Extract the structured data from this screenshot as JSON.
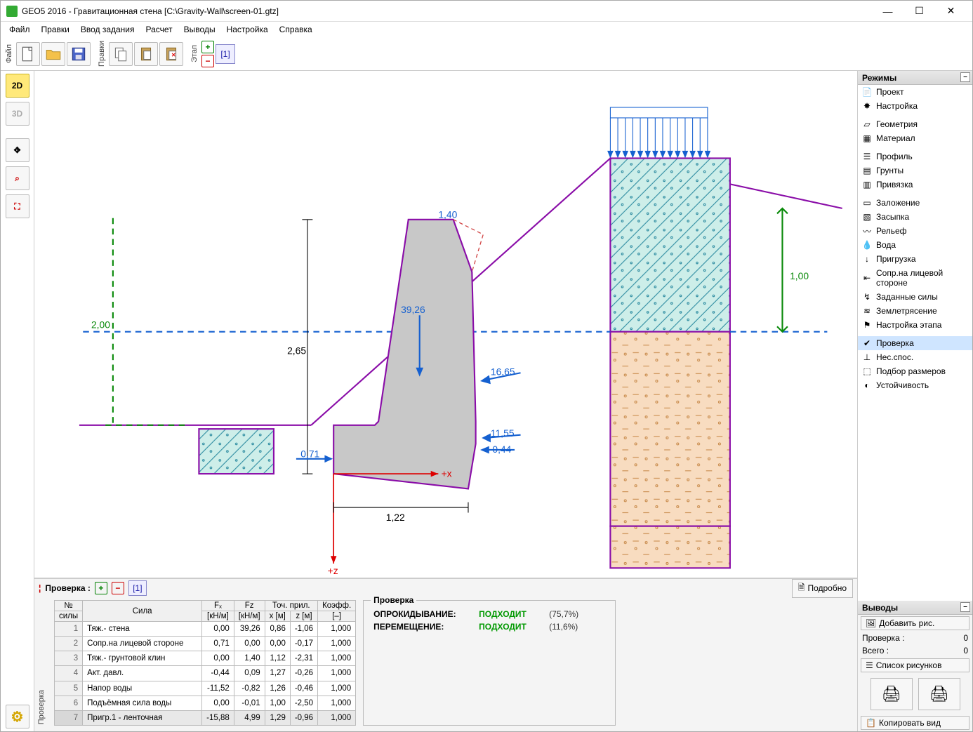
{
  "window": {
    "title": "GEO5 2016 - Гравитационная стена [C:\\Gravity-Wall\\screen-01.gtz]"
  },
  "menu": {
    "file": "Файл",
    "edit": "Правки",
    "input": "Ввод задания",
    "calc": "Расчет",
    "outputs": "Выводы",
    "settings": "Настройка",
    "help": "Справка"
  },
  "toolbar": {
    "file_label": "Файл",
    "edit_label": "Правки",
    "stage_label": "Этап",
    "stage_num": "[1]"
  },
  "left": {
    "d2": "2D",
    "d3": "3D"
  },
  "modes": {
    "header": "Режимы",
    "items": [
      "Проект",
      "Настройка",
      "Геометрия",
      "Материал",
      "Профиль",
      "Грунты",
      "Привязка",
      "Заложение",
      "Засыпка",
      "Рельеф",
      "Вода",
      "Пригрузка",
      "Сопр.на лицевой стороне",
      "Заданные силы",
      "Землетрясение",
      "Настройка этапа",
      "Проверка",
      "Нес.спос.",
      "Подбор размеров",
      "Устойчивость"
    ]
  },
  "outputs": {
    "header": "Выводы",
    "add_pic": "Добавить рис.",
    "check": "Проверка :",
    "check_n": "0",
    "total": "Всего :",
    "total_n": "0",
    "list": "Список рисунков",
    "copy": "Копировать вид"
  },
  "bottom": {
    "vlabel": "Проверка",
    "label": "Проверка :",
    "stage": "[1]",
    "detail": "Подробно"
  },
  "table": {
    "h_no": "№",
    "h_no2": "силы",
    "h_force": "Сила",
    "h_fx": "Fₓ",
    "h_fx2": "[кН/м]",
    "h_fz": "Fz",
    "h_fz2": "[кН/м]",
    "h_pt": "Точ. прил.",
    "h_x": "x [м]",
    "h_z": "z [м]",
    "h_k": "Коэфф.",
    "h_k2": "[–]",
    "rows": [
      {
        "n": "1",
        "name": "Тяж.- стена",
        "fx": "0,00",
        "fz": "39,26",
        "x": "0,86",
        "z": "-1,06",
        "k": "1,000"
      },
      {
        "n": "2",
        "name": "Сопр.на лицевой стороне",
        "fx": "0,71",
        "fz": "0,00",
        "x": "0,00",
        "z": "-0,17",
        "k": "1,000"
      },
      {
        "n": "3",
        "name": "Тяж.- грунтовой клин",
        "fx": "0,00",
        "fz": "1,40",
        "x": "1,12",
        "z": "-2,31",
        "k": "1,000"
      },
      {
        "n": "4",
        "name": "Акт. давл.",
        "fx": "-0,44",
        "fz": "0,09",
        "x": "1,27",
        "z": "-0,26",
        "k": "1,000"
      },
      {
        "n": "5",
        "name": "Напор воды",
        "fx": "-11,52",
        "fz": "-0,82",
        "x": "1,26",
        "z": "-0,46",
        "k": "1,000"
      },
      {
        "n": "6",
        "name": "Подъёмная сила воды",
        "fx": "0,00",
        "fz": "-0,01",
        "x": "1,00",
        "z": "-2,50",
        "k": "1,000"
      },
      {
        "n": "7",
        "name": "Пригр.1 - ленточная",
        "fx": "-15,88",
        "fz": "4,99",
        "x": "1,29",
        "z": "-0,96",
        "k": "1,000"
      }
    ]
  },
  "check": {
    "legend": "Проверка",
    "r1k": "ОПРОКИДЫВАНИЕ:",
    "r1v": "ПОДХОДИТ",
    "r1p": "(75,7%)",
    "r2k": "ПЕРЕМЕЩЕНИЕ:",
    "r2v": "ПОДХОДИТ",
    "r2p": "(11,6%)"
  },
  "diagram": {
    "d_2_00": "2,00",
    "d_1_00": "1,00",
    "d_2_65": "2,65",
    "d_1_22": "1,22",
    "d_0_71": "0,71",
    "d_1_40": "1,40",
    "d_39_26": "39,26",
    "d_16_65": "16,65",
    "d_11_55": "11,55",
    "d_0_44": "-0,44",
    "ax_x": "+x",
    "ax_z": "+z"
  }
}
